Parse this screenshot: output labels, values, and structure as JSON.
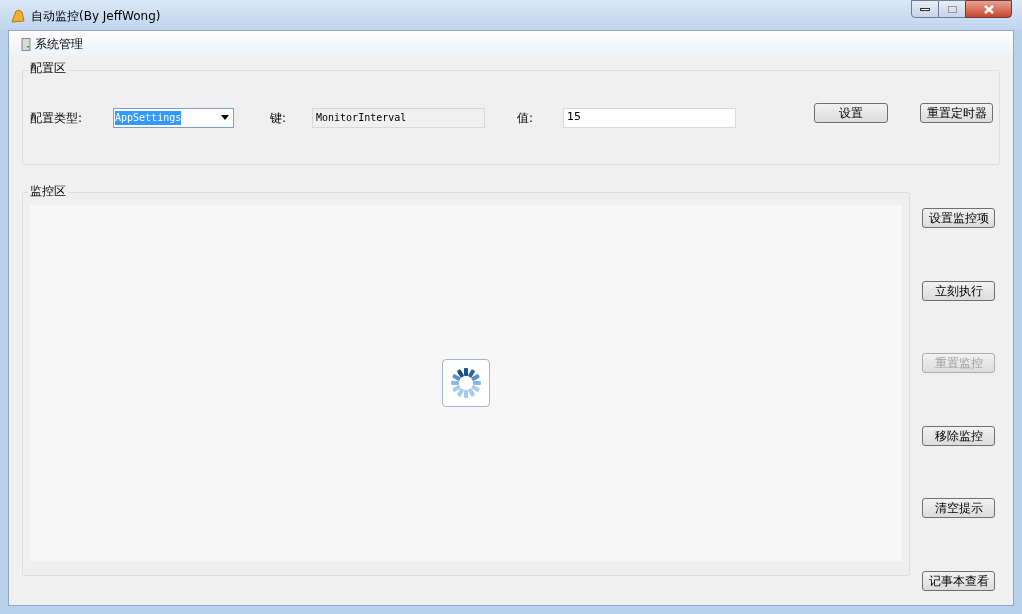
{
  "window": {
    "title": "自动监控(By JeffWong)"
  },
  "menu": [
    {
      "label": "系统管理"
    }
  ],
  "config": {
    "title": "配置区",
    "type_label": "配置类型:",
    "type_value": "AppSettings",
    "key_label": "键:",
    "key_value": "MonitorInterval",
    "key_readonly": true,
    "value_label": "值:",
    "value": "15",
    "set_button": {
      "label": "设置",
      "disabled": false
    },
    "reset_button": {
      "label": "重置定时器",
      "disabled": false
    }
  },
  "monitor": {
    "title": "监控区",
    "loading": true
  },
  "actions": [
    {
      "label": "设置监控项",
      "disabled": false
    },
    {
      "label": "立刻执行",
      "disabled": false
    },
    {
      "label": "重置监控",
      "disabled": true
    },
    {
      "label": "移除监控",
      "disabled": false
    },
    {
      "label": "清空提示",
      "disabled": false
    },
    {
      "label": "记事本查看",
      "disabled": false
    }
  ]
}
